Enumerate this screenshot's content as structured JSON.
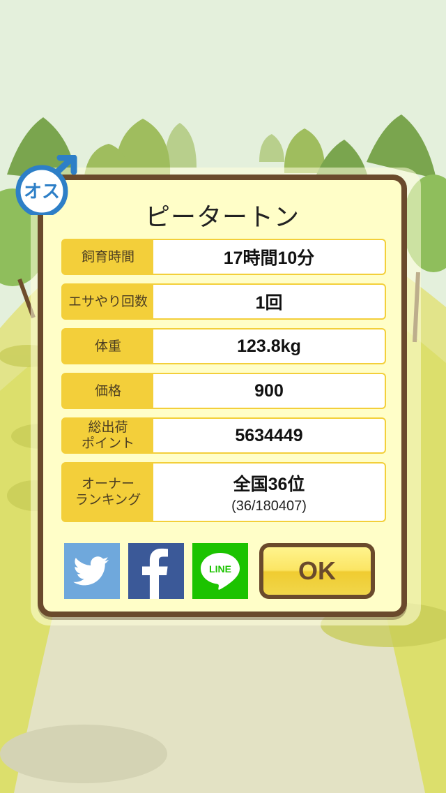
{
  "pet": {
    "name": "ピータートン",
    "gender_icon": "male-symbol-icon",
    "gender_text": "オス"
  },
  "stats": [
    {
      "label": "飼育時間",
      "value": "17時間10分"
    },
    {
      "label": "エサやり回数",
      "value": "1回"
    },
    {
      "label": "体重",
      "value": "123.8kg"
    },
    {
      "label": "価格",
      "value": "900"
    },
    {
      "label": "総出荷\nポイント",
      "value": "5634449"
    },
    {
      "label": "オーナー\nランキング",
      "value": "全国36位",
      "sub": "(36/180407)"
    }
  ],
  "share": {
    "twitter_icon": "twitter-bird-icon",
    "facebook_icon": "facebook-f-icon",
    "line_icon": "line-bubble-icon",
    "line_text": "LINE"
  },
  "ok_label": "OK",
  "colors": {
    "frame": "#6a4a2c",
    "panel": "#fffec8",
    "label_bg": "#f3cf3a",
    "twitter": "#6fa8dc",
    "facebook": "#3b5998",
    "line": "#1cc300"
  }
}
